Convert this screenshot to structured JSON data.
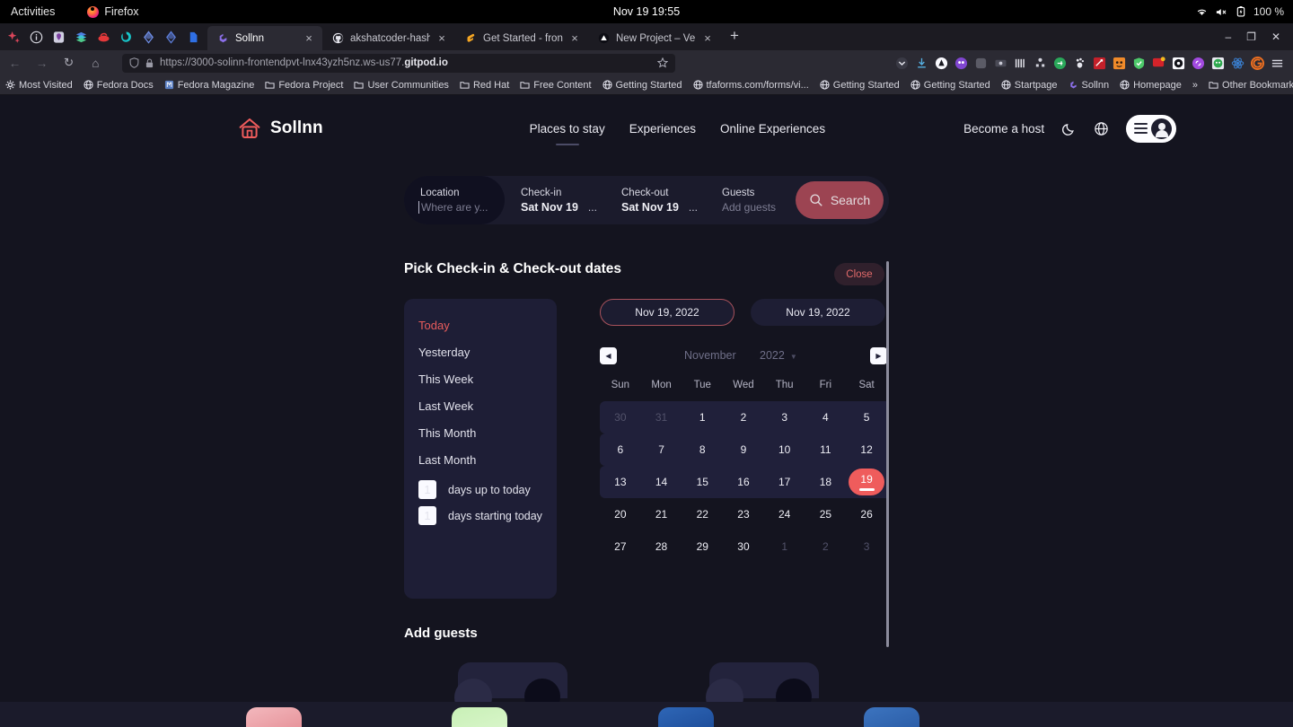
{
  "os_bar": {
    "activities": "Activities",
    "app_name": "Firefox",
    "clock": "Nov 19  19:55",
    "battery": "100 %",
    "icons": [
      "wifi-icon",
      "volume-muted-icon",
      "battery-icon"
    ]
  },
  "browser": {
    "tabs": [
      {
        "label": "Sollnn",
        "favicon": "gitpod-icon",
        "active": true,
        "close": "×"
      },
      {
        "label": "akshatcoder-hash/fronten",
        "favicon": "github-icon",
        "active": false,
        "close": "×"
      },
      {
        "label": "Get Started - frontend-pv",
        "favicon": "gitpod-icon",
        "active": false,
        "close": "×"
      },
      {
        "label": "New Project – Vercel",
        "favicon": "vercel-icon",
        "active": false,
        "close": "×"
      }
    ],
    "new_tab_label": "+",
    "window_controls": {
      "minimize": "–",
      "maximize": "❐",
      "close": "✕"
    },
    "nav": {
      "back": "←",
      "forward": "→",
      "reload": "↻",
      "home": "⌂"
    },
    "url": {
      "prefix": "https://3000-solinn-frontendpvt-lnx43yzh5nz.ws-us77.",
      "domain": "gitpod.io",
      "shield_icon": "shield-icon",
      "lock_icon": "lock-icon",
      "bookmark_icon": "star-icon"
    },
    "bookmarks": [
      {
        "label": "Most Visited",
        "icon": "gear-icon"
      },
      {
        "label": "Fedora Docs",
        "icon": "globe-icon"
      },
      {
        "label": "Fedora Magazine",
        "icon": "magazine-icon"
      },
      {
        "label": "Fedora Project",
        "icon": "folder-icon"
      },
      {
        "label": "User Communities",
        "icon": "folder-icon"
      },
      {
        "label": "Red Hat",
        "icon": "folder-icon"
      },
      {
        "label": "Free Content",
        "icon": "folder-icon"
      },
      {
        "label": "Getting Started",
        "icon": "globe-icon"
      },
      {
        "label": "tfaforms.com/forms/vi...",
        "icon": "globe-icon"
      },
      {
        "label": "Getting Started",
        "icon": "globe-icon"
      },
      {
        "label": "Getting Started",
        "icon": "globe-icon"
      },
      {
        "label": "Startpage",
        "icon": "globe-icon"
      },
      {
        "label": "Sollnn",
        "icon": "gitpod-icon"
      },
      {
        "label": "Homepage",
        "icon": "globe-icon"
      }
    ],
    "bookmarks_overflow": "»",
    "other_bookmarks": {
      "label": "Other Bookmarks",
      "icon": "folder-icon"
    }
  },
  "site": {
    "brand": {
      "name": "Sollnn",
      "logo_icon": "house-icon",
      "logo_color": "#ef5c5c"
    },
    "nav": [
      {
        "label": "Places to stay",
        "current": true
      },
      {
        "label": "Experiences",
        "current": false
      },
      {
        "label": "Online Experiences",
        "current": false
      }
    ],
    "become_host": "Become a host",
    "theme_icon": "moon-icon",
    "language_icon": "globe-icon",
    "account_menu": {
      "menu_icon": "hamburger-icon",
      "avatar_icon": "user-avatar-icon"
    }
  },
  "search": {
    "location": {
      "label": "Location",
      "placeholder": "Where are y..."
    },
    "checkin": {
      "label": "Check-in",
      "value": "Sat Nov 19",
      "more": "..."
    },
    "checkout": {
      "label": "Check-out",
      "value": "Sat Nov 19",
      "more": "..."
    },
    "guests": {
      "label": "Guests",
      "placeholder": "Add guests"
    },
    "button": {
      "label": "Search",
      "icon": "search-icon",
      "color": "#9c4452"
    }
  },
  "picker": {
    "title": "Pick Check-in & Check-out dates",
    "close_label": "Close",
    "shortcuts": [
      {
        "label": "Today",
        "active": true
      },
      {
        "label": "Yesterday",
        "active": false
      },
      {
        "label": "This Week",
        "active": false
      },
      {
        "label": "Last Week",
        "active": false
      },
      {
        "label": "This Month",
        "active": false
      },
      {
        "label": "Last Month",
        "active": false
      }
    ],
    "days_up_to_today": {
      "value": "1",
      "label": "days up to today"
    },
    "days_starting_today": {
      "value": "1",
      "label": "days starting today"
    },
    "chips": [
      {
        "value": "Nov 19, 2022",
        "selected": true
      },
      {
        "value": "Nov 19, 2022",
        "selected": false
      }
    ],
    "prev_icon": "chevron-left-icon",
    "next_icon": "chevron-right-icon",
    "month": "November",
    "year": "2022",
    "weekdays": [
      "Sun",
      "Mon",
      "Tue",
      "Wed",
      "Thu",
      "Fri",
      "Sat"
    ],
    "weeks": [
      [
        {
          "d": "30",
          "out": true
        },
        {
          "d": "31",
          "out": true
        },
        {
          "d": "1"
        },
        {
          "d": "2"
        },
        {
          "d": "3"
        },
        {
          "d": "4"
        },
        {
          "d": "5"
        }
      ],
      [
        {
          "d": "6"
        },
        {
          "d": "7"
        },
        {
          "d": "8"
        },
        {
          "d": "9"
        },
        {
          "d": "10"
        },
        {
          "d": "11"
        },
        {
          "d": "12"
        }
      ],
      [
        {
          "d": "13"
        },
        {
          "d": "14"
        },
        {
          "d": "15"
        },
        {
          "d": "16"
        },
        {
          "d": "17"
        },
        {
          "d": "18"
        },
        {
          "d": "19",
          "selected": true
        }
      ],
      [
        {
          "d": "20"
        },
        {
          "d": "21"
        },
        {
          "d": "22"
        },
        {
          "d": "23"
        },
        {
          "d": "24"
        },
        {
          "d": "25"
        },
        {
          "d": "26"
        }
      ],
      [
        {
          "d": "27"
        },
        {
          "d": "28"
        },
        {
          "d": "29"
        },
        {
          "d": "30"
        },
        {
          "d": "1",
          "out": true
        },
        {
          "d": "2",
          "out": true
        },
        {
          "d": "3",
          "out": true
        }
      ]
    ],
    "selected_day_color": "#ef5c5c",
    "highlight_row_color": "#20203a"
  },
  "guests_section": {
    "title": "Add guests"
  }
}
